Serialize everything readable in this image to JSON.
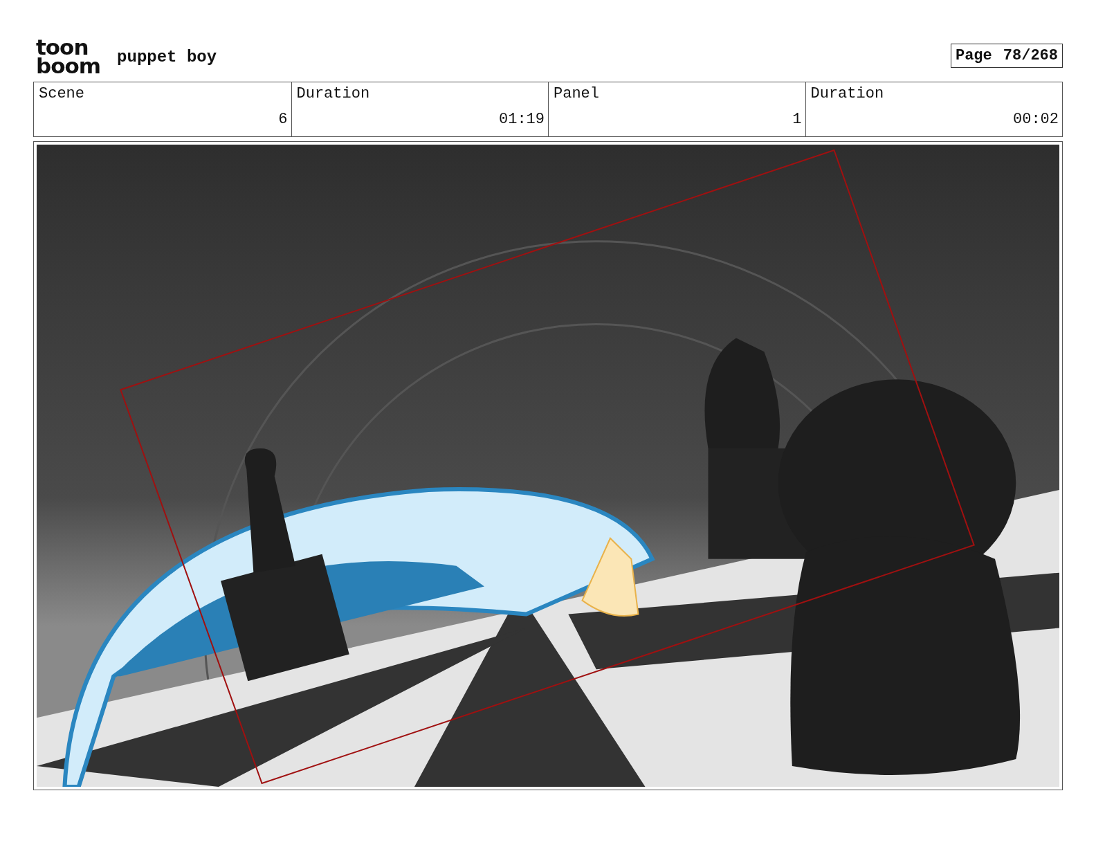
{
  "logo": {
    "top": "toon",
    "bottom": "boom"
  },
  "project_title": "puppet boy",
  "page": {
    "label": "Page",
    "value": "78/268"
  },
  "info": {
    "labels": [
      "Scene",
      "Duration",
      "Panel",
      "Duration"
    ],
    "values": [
      "6",
      "01:19",
      "1",
      "00:02"
    ]
  }
}
